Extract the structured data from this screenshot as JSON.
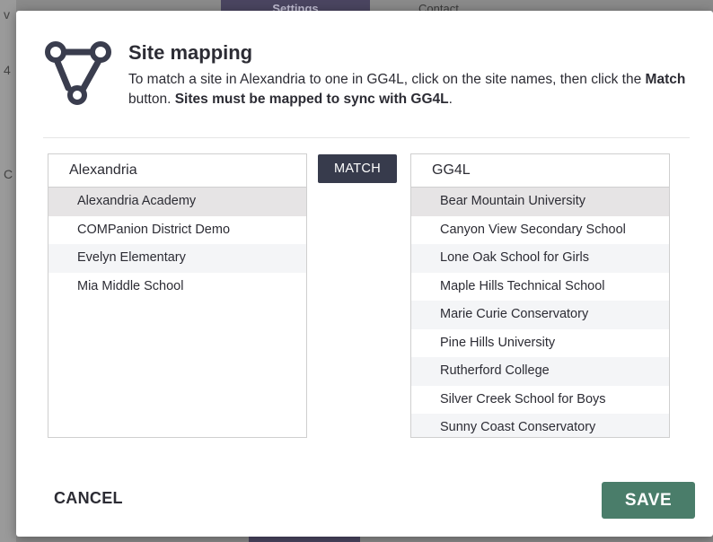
{
  "background": {
    "active_tab": "Settings",
    "tab_contact": "Contact",
    "left_fragments": [
      "v",
      "4",
      "C"
    ]
  },
  "modal": {
    "title": "Site mapping",
    "description_part1": "To match a site in Alexandria to one in GG4L, click on the site names, then click the ",
    "description_bold1": "Match",
    "description_part2": " button. ",
    "description_bold2": "Sites must be mapped to sync with GG4L",
    "description_part3": ".",
    "match_label": "MATCH",
    "cancel_label": "CANCEL",
    "save_label": "SAVE",
    "left_panel": {
      "header": "Alexandria",
      "items": [
        "Alexandria Academy",
        "COMPanion District Demo",
        "Evelyn Elementary",
        "Mia Middle School"
      ],
      "selected_index": 0
    },
    "right_panel": {
      "header": "GG4L",
      "items": [
        "Bear Mountain University",
        "Canyon View Secondary School",
        "Lone Oak School for Girls",
        "Maple Hills Technical School",
        "Marie Curie Conservatory",
        "Pine Hills University",
        "Rutherford College",
        "Silver Creek School for Boys",
        "Sunny Coast Conservatory"
      ],
      "selected_index": 0
    }
  },
  "colors": {
    "save_button": "#4a7d6a",
    "match_button": "#373b4c",
    "logo": "#3a3d4e"
  },
  "icons": {
    "logo": "site-mapping-logo-icon"
  }
}
